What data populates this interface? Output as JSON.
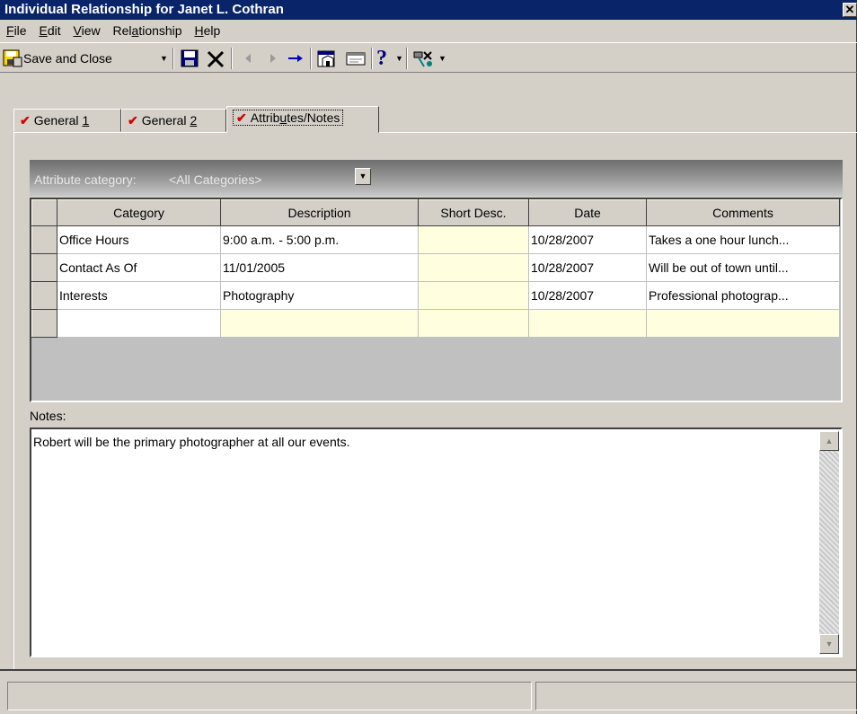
{
  "window": {
    "title": "Individual Relationship for Janet L. Cothran",
    "close_glyph": "✕"
  },
  "menu": [
    {
      "label": "File",
      "accel": "F",
      "rest": "ile"
    },
    {
      "label": "Edit",
      "accel": "E",
      "rest": "dit"
    },
    {
      "label": "View",
      "accel": "V",
      "rest": "iew"
    },
    {
      "label": "Relationship",
      "pre": "Rel",
      "accel": "a",
      "rest": "tionship"
    },
    {
      "label": "Help",
      "accel": "H",
      "rest": "elp"
    }
  ],
  "toolbar": {
    "save_close_label": "Save and Close",
    "icons": [
      "save-icon",
      "delete-icon",
      "previous-icon",
      "next-icon",
      "goto-icon",
      "properties-icon",
      "card-icon",
      "help-icon",
      "tools-icon"
    ]
  },
  "tabs": [
    {
      "pre": "General ",
      "accel": "1",
      "post": ""
    },
    {
      "pre": "General ",
      "accel": "2",
      "post": ""
    },
    {
      "pre": "Attrib",
      "accel": "u",
      "post": "tes/Notes"
    }
  ],
  "attribute_category": {
    "label": "Attribute category:",
    "value": "<All Categories>"
  },
  "grid": {
    "columns": [
      "Category",
      "Description",
      "Short Desc.",
      "Date",
      "Comments"
    ],
    "rows": [
      [
        "Office Hours",
        "9:00 a.m. - 5:00 p.m.",
        "",
        "10/28/2007",
        "Takes a one hour lunch..."
      ],
      [
        "Contact As Of",
        "11/01/2005",
        "",
        "10/28/2007",
        "Will be out of town until..."
      ],
      [
        "Interests",
        "Photography",
        "",
        "10/28/2007",
        "Professional photograp..."
      ]
    ]
  },
  "notes": {
    "label": "Notes:",
    "text": "Robert will be the primary photographer at all our events."
  },
  "colors": {
    "titlebar": "#0a246a",
    "face": "#d4d0c8",
    "check": "#d40000",
    "new_row": "#ffffe0"
  }
}
